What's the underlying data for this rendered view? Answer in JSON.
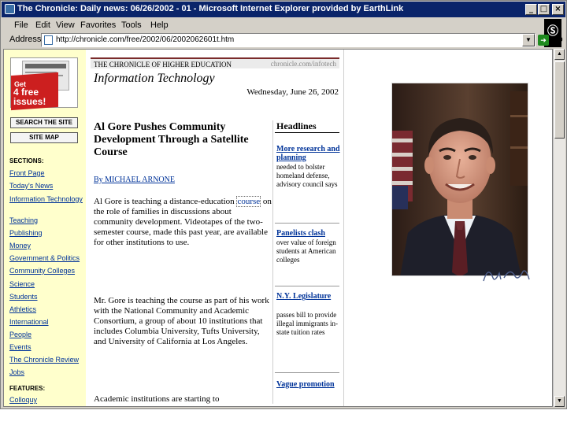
{
  "window": {
    "title": "The Chronicle: Daily news: 06/26/2002 - 01 - Microsoft Internet Explorer provided by EarthLink",
    "buttons": {
      "minimize": "_",
      "maximize": "□",
      "close": "×"
    }
  },
  "menu": [
    "File",
    "Edit",
    "View",
    "Favorites",
    "Tools",
    "Help"
  ],
  "address": {
    "label": "Address",
    "url": "http://chronicle.com/free/2002/06/2002062601t.htm",
    "go": "Go"
  },
  "nav": {
    "promo": {
      "get": "Get",
      "main": "4 free issues!"
    },
    "search_button": "SEARCH THE SITE",
    "sitemap_button": "SITE MAP",
    "sections_heading": "SECTIONS:",
    "sections": [
      "Front Page",
      "Today's News",
      "Information Technology",
      "Teaching",
      "Publishing",
      "Money",
      "Government & Politics",
      "Community Colleges",
      "Science",
      "Students",
      "Athletics",
      "International",
      "People",
      "Events",
      "The Chronicle Review",
      "Jobs"
    ],
    "features_heading": "FEATURES:",
    "features": [
      "Colloquy"
    ]
  },
  "article": {
    "masthead": "THE CHRONICLE OF HIGHER EDUCATION",
    "masthead_url": "chronicle.com/infotech",
    "section_title": "Information Technology",
    "date": "Wednesday, June 26, 2002",
    "headline": "Al Gore Pushes Community Development Through a Satellite Course",
    "byline": "By MICHAEL ARNONE",
    "p1_before": "Al Gore is teaching a distance-education ",
    "p1_link": "course",
    "p1_after": " on the role of families in discussions about community development. Videotapes of the two-semester course, made this past year, are available for other institutions to use.",
    "p2": "Mr. Gore is teaching the course as part of his work with the National Community and Academic Consortium, a group of about 10 institutions that includes Columbia University, Tufts University, and University of California at Los Angeles.",
    "p3": "Academic institutions are starting to"
  },
  "headlines": {
    "title": "Headlines",
    "items": [
      {
        "link": "More research and planning",
        "desc": "needed to bolster homeland defense, advisory council says"
      },
      {
        "link": "Panelists clash",
        "desc": "over value of foreign students at American colleges"
      },
      {
        "link": "N.Y. Legislature",
        "desc": "passes bill to provide illegal immigrants in-state tuition rates"
      },
      {
        "link": "Vague promotion",
        "desc": ""
      }
    ]
  },
  "portrait": {
    "signature": "Al Gore"
  },
  "colors": {
    "titlebar": "#0a246a",
    "chrome": "#d4d0c8",
    "nav_bg": "#ffffcc",
    "link": "#003399",
    "promo_red": "#cc1f1f"
  }
}
